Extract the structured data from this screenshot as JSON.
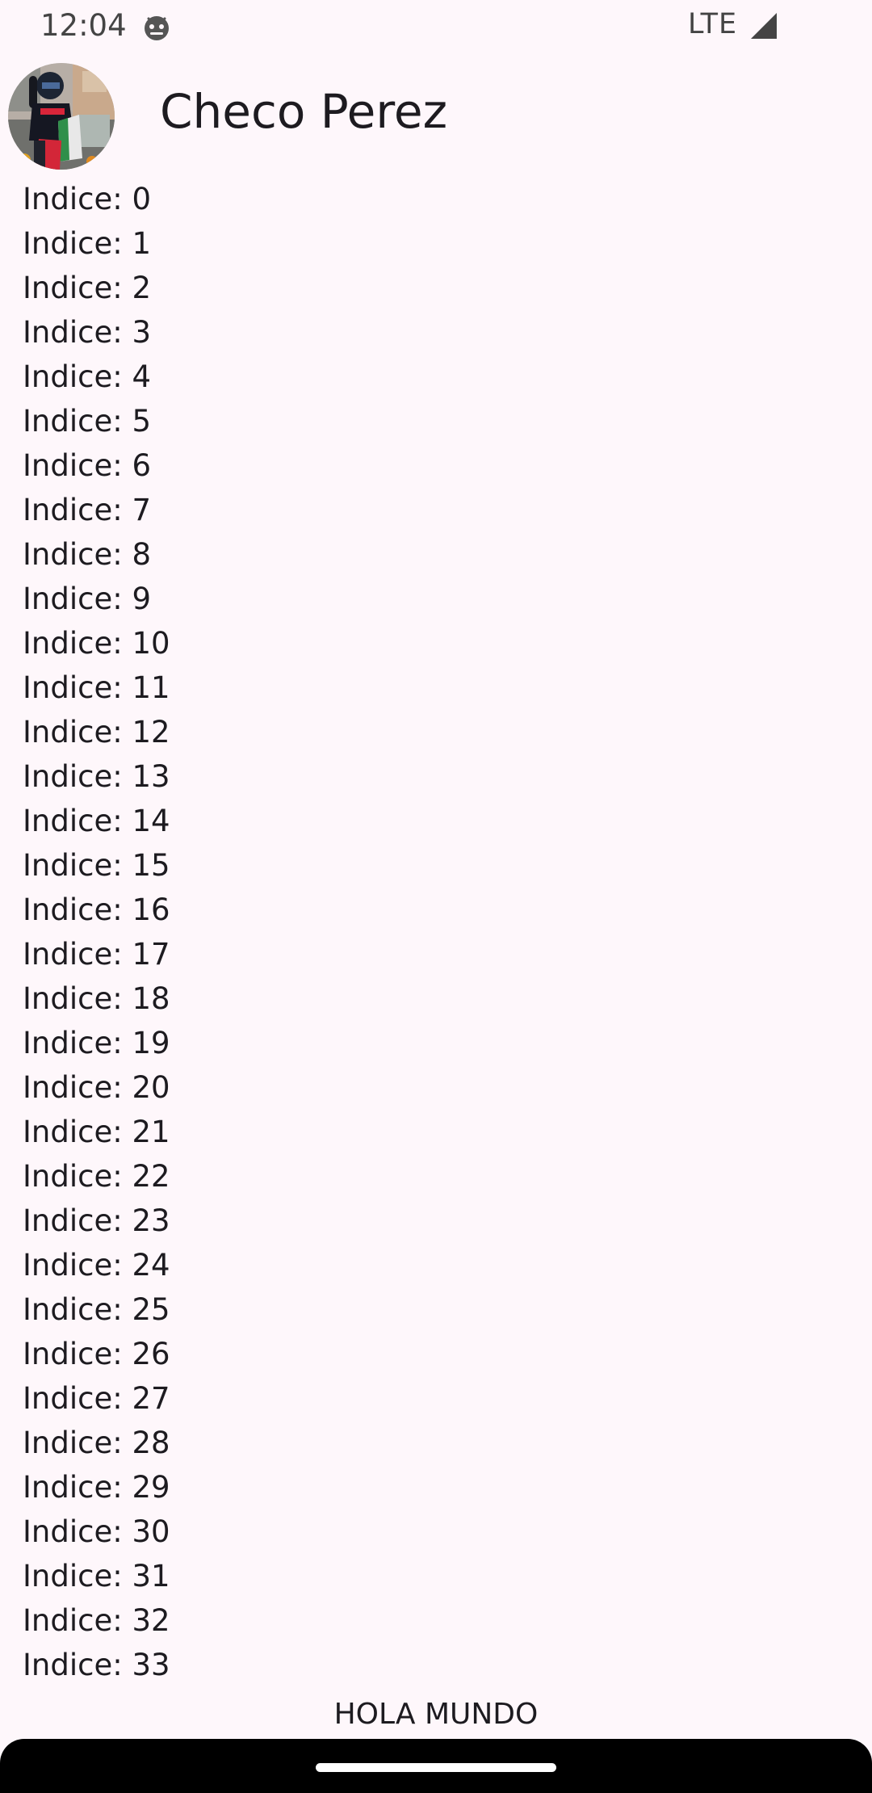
{
  "status_bar": {
    "time": "12:04",
    "app_icon": "android-debug-icon",
    "network": "LTE",
    "signal_icon": "signal-icon"
  },
  "header": {
    "title": "Checo Perez",
    "avatar_icon": "profile-photo"
  },
  "list": {
    "items": [
      "Indice: 0",
      "Indice: 1",
      "Indice: 2",
      "Indice: 3",
      "Indice: 4",
      "Indice: 5",
      "Indice: 6",
      "Indice: 7",
      "Indice: 8",
      "Indice: 9",
      "Indice: 10",
      "Indice: 11",
      "Indice: 12",
      "Indice: 13",
      "Indice: 14",
      "Indice: 15",
      "Indice: 16",
      "Indice: 17",
      "Indice: 18",
      "Indice: 19",
      "Indice: 20",
      "Indice: 21",
      "Indice: 22",
      "Indice: 23",
      "Indice: 24",
      "Indice: 25",
      "Indice: 26",
      "Indice: 27",
      "Indice: 28",
      "Indice: 29",
      "Indice: 30",
      "Indice: 31",
      "Indice: 32",
      "Indice: 33"
    ]
  },
  "footer": {
    "text": "HOLA MUNDO"
  },
  "colors": {
    "background": "#fef7fb",
    "text": "#1d1b20",
    "nav_bar": "#000000"
  }
}
